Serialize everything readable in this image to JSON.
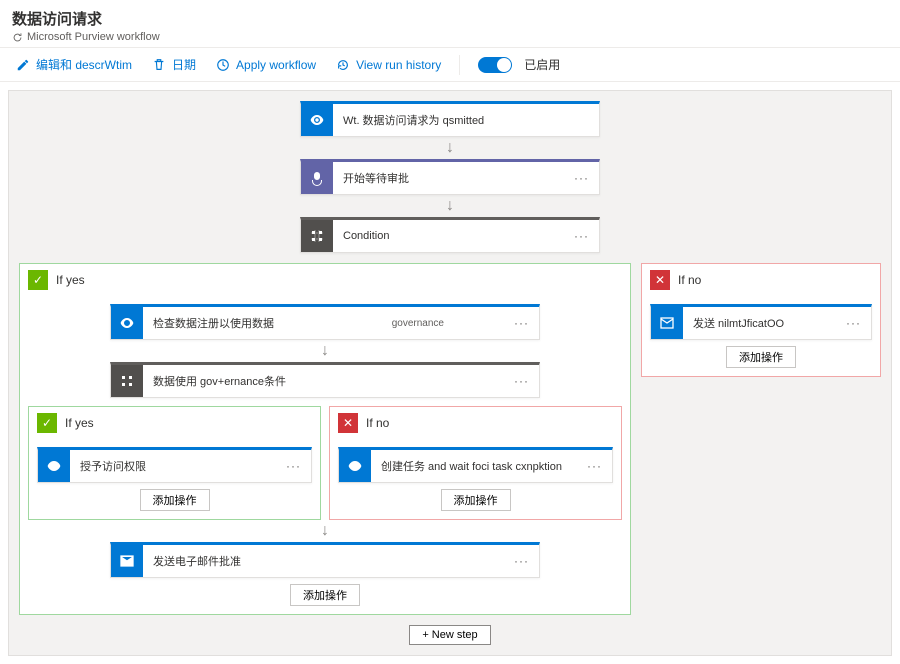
{
  "header": {
    "title": "数据访问请求",
    "subtitle": "Microsoft Purview workflow"
  },
  "toolbar": {
    "edit": "编辑和 descrWtim",
    "date": "日期",
    "apply": "Apply workflow",
    "history": "View run history",
    "enabled": "已启用"
  },
  "flow": {
    "trigger": "Wt. 数据访问请求为 qsmitted",
    "approval": "开始等待审批",
    "condition": "Condition",
    "yes": "If yes",
    "no": "If no",
    "addAction": "添加操作",
    "newStep": "+ New step",
    "outerYes": {
      "check": {
        "title": "检查数据注册以使用数据",
        "sub": "governance"
      },
      "dataCond": "数据使用 gov+ernance条件",
      "innerYes": {
        "grant": "授予访问权限"
      },
      "innerNo": {
        "task": "创建任务 and wait foci task cxnpktion"
      },
      "emailApprove": "发送电子邮件批准"
    },
    "outerNo": {
      "notify": "发送 nilmtJficatOO"
    }
  }
}
